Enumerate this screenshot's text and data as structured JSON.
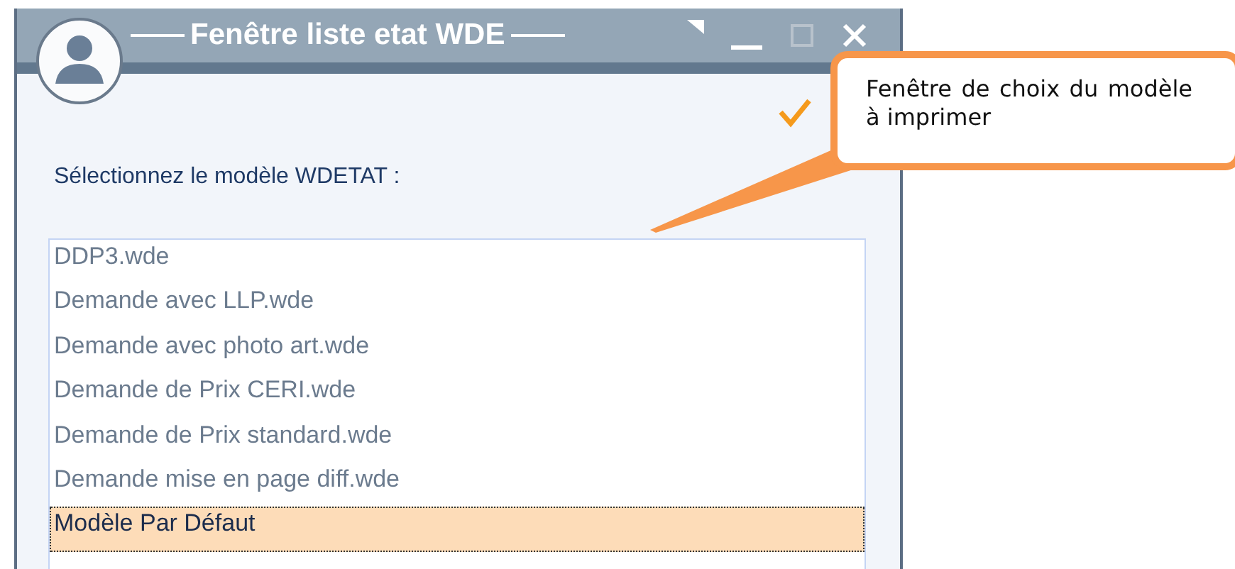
{
  "window": {
    "title": "Fenêtre liste etat WDE",
    "maximize_disabled": true
  },
  "prompt": "Sélectionnez le modèle WDETAT :",
  "list": [
    {
      "label": "DDP3.wde",
      "selected": false
    },
    {
      "label": "Demande avec LLP.wde",
      "selected": false
    },
    {
      "label": "Demande avec photo art.wde",
      "selected": false
    },
    {
      "label": "Demande de Prix CERI.wde",
      "selected": false
    },
    {
      "label": "Demande de Prix standard.wde",
      "selected": false
    },
    {
      "label": "Demande mise en page diff.wde",
      "selected": false
    },
    {
      "label": "Modèle Par Défaut",
      "selected": true
    }
  ],
  "callout": {
    "text": "Fenêtre de choix du modèle à imprimer"
  }
}
